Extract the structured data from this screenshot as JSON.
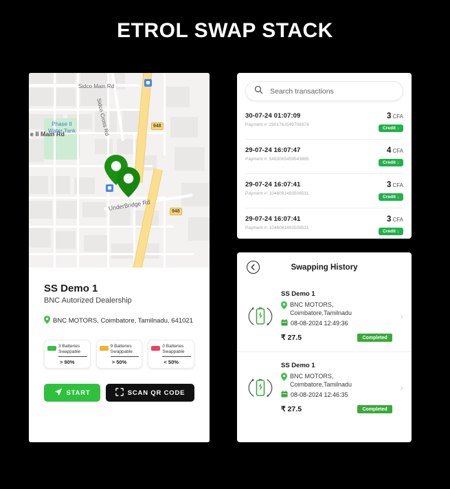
{
  "app": {
    "title": "ETROL SWAP STACK"
  },
  "map": {
    "labels": [
      {
        "text": "Sidco Main Rd"
      },
      {
        "text": "Sidco Cross Rd"
      },
      {
        "text": "e II Main Rd"
      },
      {
        "text": "UnderBridge Rd"
      }
    ],
    "park_label_line1": "Phase II",
    "park_label_line2": "Water Tank",
    "highway_shield_1": "948",
    "highway_shield_2": "948",
    "marker_color": "#1a9112",
    "pin_count": 2
  },
  "station": {
    "name": "SS Demo 1",
    "subtitle": "BNC Autorized Dealership",
    "address": "BNC MOTORS, Coimbatore, Tamilnadu, 641021",
    "location_icon": "map-pin-icon",
    "chips": [
      {
        "count_label": "3 Batteries",
        "swappable_label": "Swappable",
        "percent": "> 90%",
        "color": "#31c04a",
        "fill": 100
      },
      {
        "count_label": "9 Batteries",
        "swappable_label": "Swappable",
        "percent": "> 50%",
        "color": "#f5b22a",
        "fill": 55
      },
      {
        "count_label": "0 Batteries",
        "swappable_label": "Swappable",
        "percent": "< 50%",
        "color": "#f0415f",
        "fill": 35
      }
    ],
    "start_button": "START",
    "scan_button": "SCAN QR CODE",
    "start_icon": "navigation-arrow-icon",
    "scan_icon": "qr-scan-icon"
  },
  "transactions": {
    "search_placeholder": "Search transactions",
    "search_value": "",
    "search_icon": "search-icon",
    "rows": [
      {
        "date": "30-07-24 01:07:09",
        "payment": "Payment #: 2901762549708374",
        "amount": "3",
        "currency": "CFA",
        "badge": "Credit ↓"
      },
      {
        "date": "29-07-24 16:07:47",
        "payment": "Payment #: 5483065459543885",
        "amount": "4",
        "currency": "CFA",
        "badge": "Credit ↓"
      },
      {
        "date": "29-07-24 16:07:41",
        "payment": "Payment #: 1046081493508531",
        "amount": "3",
        "currency": "CFA",
        "badge": "Credit ↓"
      },
      {
        "date": "29-07-24 16:07:41",
        "payment": "Payment #: 1046081493508531",
        "amount": "3",
        "currency": "CFA",
        "badge": "Credit ↓"
      }
    ]
  },
  "history": {
    "title": "Swapping History",
    "back_icon": "back-arrow-icon",
    "items": [
      {
        "name": "SS Demo 1",
        "location_line1": "BNC MOTORS,",
        "location_line2": "Coimbatore,Tamilnadu",
        "datetime": "08-08-2024 12:49:36",
        "price": "₹ 27.5",
        "status": "Completed",
        "swap_icon": "battery-swap-icon",
        "chevron": "chevron-right-icon"
      },
      {
        "name": "SS Demo 1",
        "location_line1": "BNC MOTORS,",
        "location_line2": "Coimbatore,Tamilnadu",
        "datetime": "08-08-2024 12:46:35",
        "price": "₹ 27.5",
        "status": "Completed",
        "swap_icon": "battery-swap-icon",
        "chevron": "chevron-right-icon"
      }
    ]
  },
  "colors": {
    "background": "#000000",
    "accent_green": "#2ec13d",
    "badge_green": "#22b14c",
    "dark_button": "#111111"
  }
}
